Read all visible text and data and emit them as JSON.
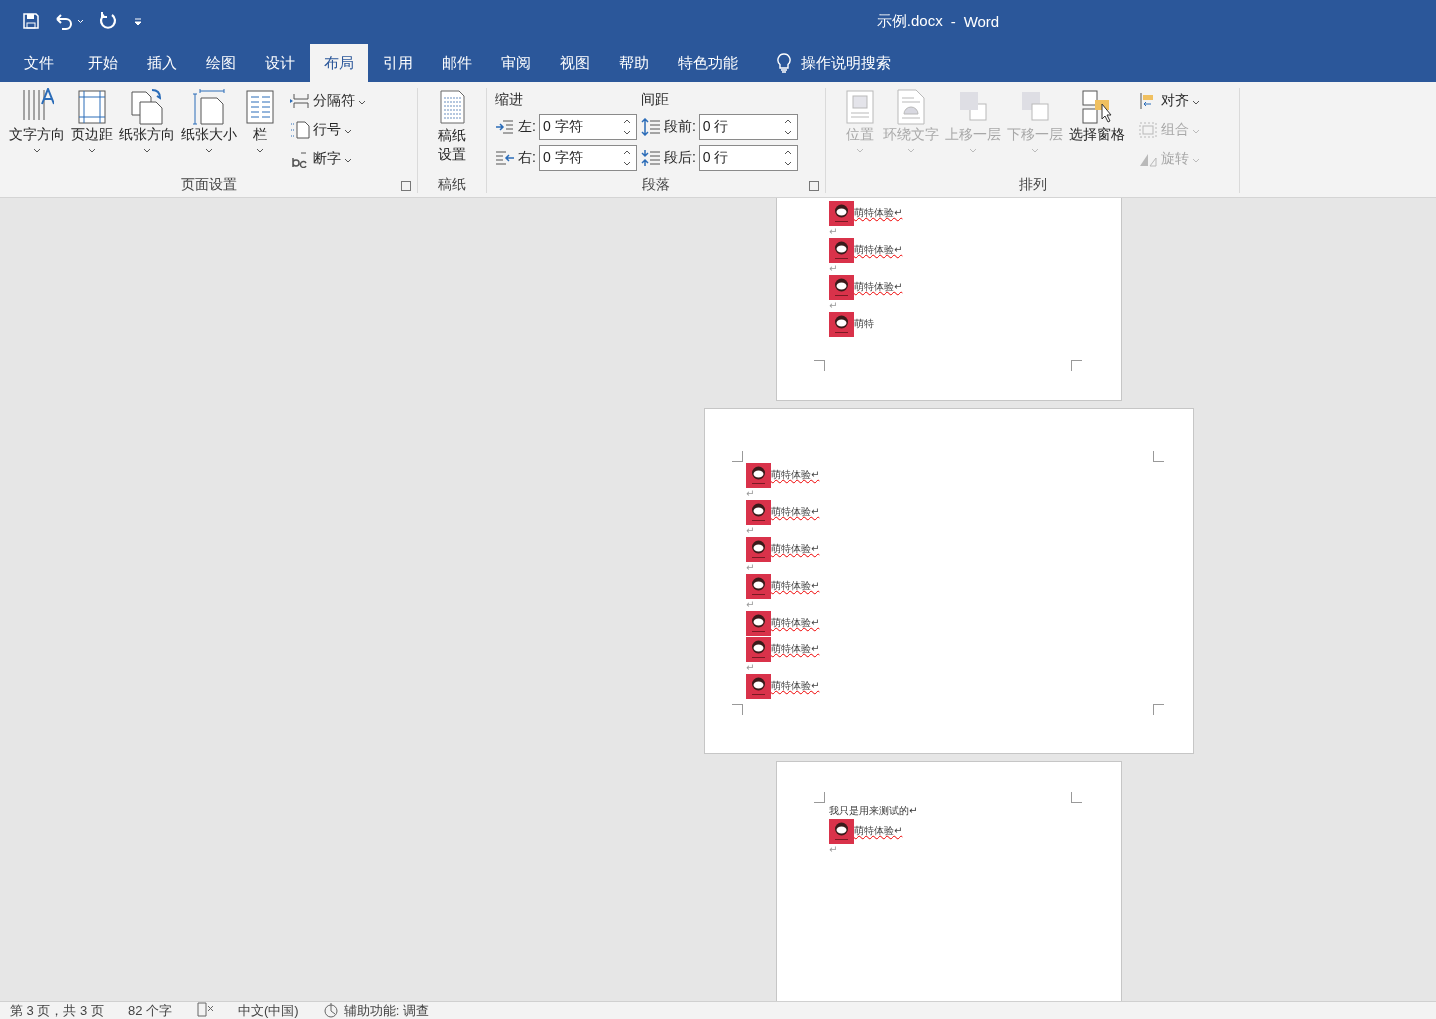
{
  "window": {
    "title": "示例.docx",
    "separator": "-",
    "app": "Word"
  },
  "tabs": [
    {
      "label": "文件",
      "selected": false
    },
    {
      "label": "开始",
      "selected": false
    },
    {
      "label": "插入",
      "selected": false
    },
    {
      "label": "绘图",
      "selected": false
    },
    {
      "label": "设计",
      "selected": false
    },
    {
      "label": "布局",
      "selected": true
    },
    {
      "label": "引用",
      "selected": false
    },
    {
      "label": "邮件",
      "selected": false
    },
    {
      "label": "审阅",
      "selected": false
    },
    {
      "label": "视图",
      "selected": false
    },
    {
      "label": "帮助",
      "selected": false
    },
    {
      "label": "特色功能",
      "selected": false
    }
  ],
  "tell_me": {
    "label": "操作说明搜索"
  },
  "ribbon": {
    "page_setup": {
      "title": "页面设置",
      "big_buttons": [
        {
          "label": "文字方向",
          "kind": "textdir"
        },
        {
          "label": "页边距",
          "kind": "margins"
        },
        {
          "label": "纸张方向",
          "kind": "orientation"
        },
        {
          "label": "纸张大小",
          "kind": "size"
        },
        {
          "label": "栏",
          "kind": "columns"
        }
      ],
      "small_buttons": [
        {
          "label": "分隔符",
          "kind": "breaks"
        },
        {
          "label": "行号",
          "kind": "linenum"
        },
        {
          "label": "断字",
          "kind": "hyphen"
        }
      ]
    },
    "manuscript": {
      "title": "稿纸",
      "button": {
        "lines": [
          "稿纸",
          "设置"
        ]
      }
    },
    "paragraph": {
      "title": "段落",
      "indent_heading": "缩进",
      "spacing_heading": "间距",
      "indent": [
        {
          "label": "左:",
          "value": "0 字符",
          "kind": "left"
        },
        {
          "label": "右:",
          "value": "0 字符",
          "kind": "right"
        }
      ],
      "spacing": [
        {
          "label": "段前:",
          "value": "0 行",
          "kind": "before"
        },
        {
          "label": "段后:",
          "value": "0 行",
          "kind": "after"
        }
      ]
    },
    "arrange": {
      "title": "排列",
      "big_buttons": [
        {
          "label": "位置",
          "disabled": true,
          "kind": "position"
        },
        {
          "label": "环绕文字",
          "disabled": true,
          "kind": "wrap"
        },
        {
          "label": "上移一层",
          "disabled": true,
          "kind": "forward"
        },
        {
          "label": "下移一层",
          "disabled": true,
          "kind": "backward"
        },
        {
          "label": "选择窗格",
          "disabled": false,
          "kind": "pane"
        }
      ],
      "small_buttons": [
        {
          "label": "对齐",
          "disabled": false,
          "kind": "align"
        },
        {
          "label": "组合",
          "disabled": true,
          "kind": "group"
        },
        {
          "label": "旋转",
          "disabled": true,
          "kind": "rotate"
        }
      ]
    }
  },
  "pages": [
    {
      "lines": [
        {
          "caption": "萌特体验↵",
          "misspelled": true
        },
        {
          "kind": "empty",
          "text": "↵"
        },
        {
          "caption": "萌特体验↵",
          "misspelled": true
        },
        {
          "kind": "empty",
          "text": "↵"
        },
        {
          "caption": "萌特体验↵",
          "misspelled": true
        },
        {
          "kind": "empty",
          "text": "↵"
        },
        {
          "caption": "萌特",
          "misspelled": false
        }
      ]
    },
    {
      "lines": [
        {
          "caption": "萌特体验↵",
          "misspelled": true
        },
        {
          "kind": "empty",
          "text": "↵"
        },
        {
          "caption": "萌特体验↵",
          "misspelled": true
        },
        {
          "kind": "empty",
          "text": "↵"
        },
        {
          "caption": "萌特体验↵",
          "misspelled": true
        },
        {
          "kind": "empty",
          "text": "↵"
        },
        {
          "caption": "萌特体验↵",
          "misspelled": true
        },
        {
          "kind": "empty",
          "text": "↵"
        },
        {
          "caption": "萌特体验↵",
          "misspelled": true
        },
        {
          "caption": "萌特体验↵",
          "misspelled": true
        },
        {
          "kind": "empty",
          "text": "↵"
        },
        {
          "caption": "萌特体验↵",
          "misspelled": true
        }
      ]
    },
    {
      "lines": [
        {
          "kind": "text",
          "text": "我只是用来测试的↵"
        },
        {
          "caption": "萌特体验↵",
          "misspelled": true
        },
        {
          "kind": "empty",
          "text": "↵"
        }
      ]
    }
  ],
  "status_bar": {
    "page": "第 3 页，共 3 页",
    "words": "82 个字",
    "language": "中文(中国)",
    "accessibility": "辅助功能: 调查"
  }
}
